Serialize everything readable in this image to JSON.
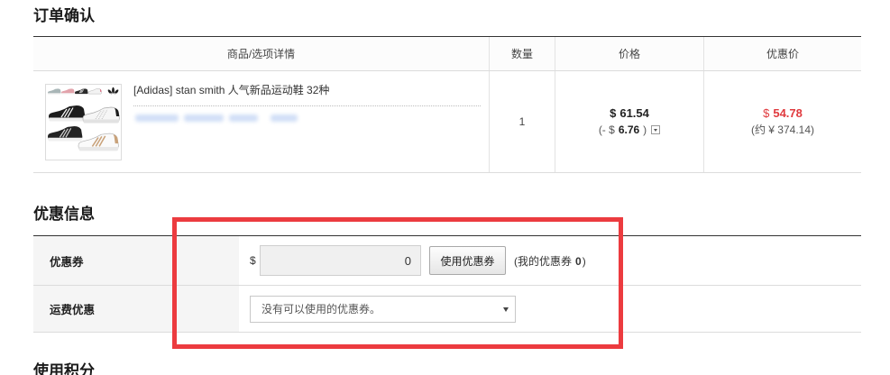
{
  "page_title": "订单确认",
  "order_table": {
    "headers": [
      "商品/选项详情",
      "数量",
      "价格",
      "优惠价"
    ],
    "rows": [
      {
        "product_name": "[Adidas] stan smith 人气新品运动鞋 32种",
        "quantity": "1",
        "price": {
          "currency": "$",
          "value": "61.54"
        },
        "discount": {
          "prefix": "(- $",
          "value": "6.76",
          "suffix": ")"
        },
        "sale_price": {
          "currency": "$",
          "value": "54.78"
        },
        "sale_price_cny": "(约 ¥ 374.14)"
      }
    ]
  },
  "discount_section": {
    "title": "优惠信息",
    "coupon": {
      "label": "优惠券",
      "currency": "$",
      "amount": "0",
      "apply_button_label": "使用优惠券",
      "my_coupons_prefix": "(我的优惠券",
      "my_coupons_count": "0",
      "my_coupons_suffix": ")"
    },
    "shipping": {
      "label": "运费优惠",
      "selected_option": "没有可以使用的优惠券。"
    }
  },
  "points_section": {
    "title": "使用积分"
  },
  "icons": {
    "discount_detail_toggle": "caret-down-icon",
    "shipping_select_arrow": "caret-down-icon",
    "product_thumbnail": "sneakers-image"
  },
  "colors": {
    "sale_price": "#e03a3e",
    "highlight_border": "#ec3b3f",
    "section_rule": "#333333"
  }
}
